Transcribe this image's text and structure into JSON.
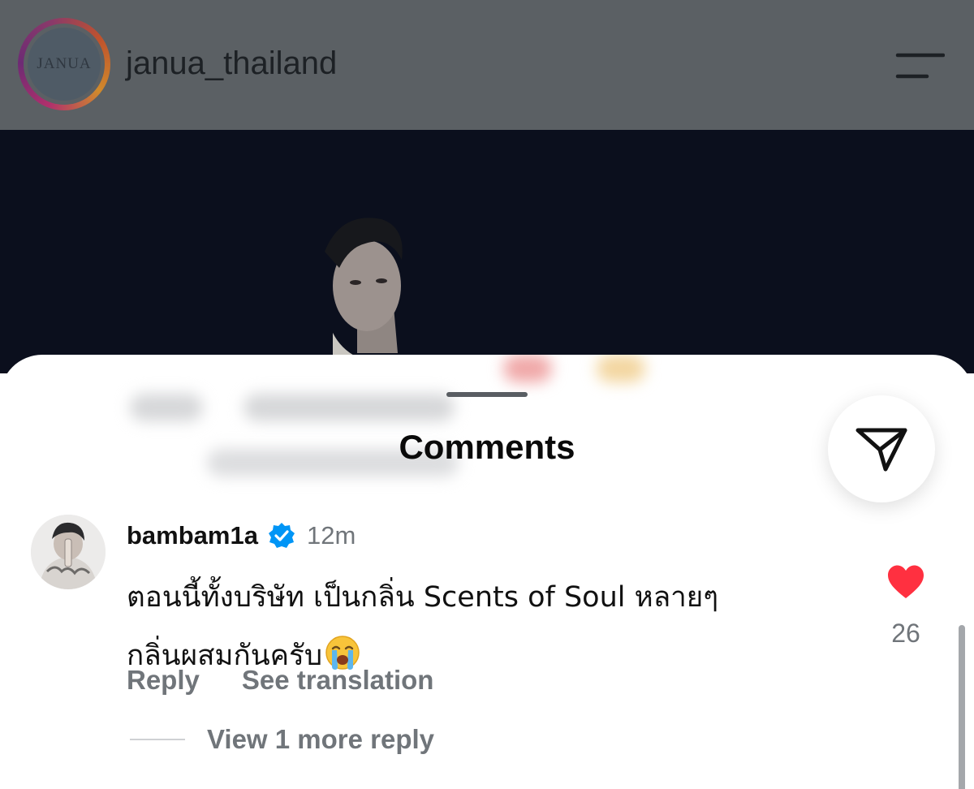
{
  "header": {
    "account_name": "janua_thailand",
    "avatar_text": "JANUA",
    "menu_icon": "menu-icon"
  },
  "sheet": {
    "title": "Comments",
    "share_icon": "send-icon"
  },
  "comment": {
    "username": "bambam1a",
    "verified": true,
    "timestamp": "12m",
    "text_line1": "ตอนนี้ทั้งบริษัท เป็นกลิ่น Scents of Soul หลายๆ",
    "text_line2": "กลิ่นผสมกันครับ",
    "emoji": "crying-face",
    "like_count": "26",
    "like_color": "#ff3040",
    "actions": {
      "reply": "Reply",
      "see_translation": "See translation"
    },
    "view_replies": "View 1 more reply"
  },
  "colors": {
    "header_bg": "#5b6064",
    "photo_bg": "#0b0f1d",
    "verified_blue": "#0095f6",
    "muted_text": "#70757a"
  }
}
